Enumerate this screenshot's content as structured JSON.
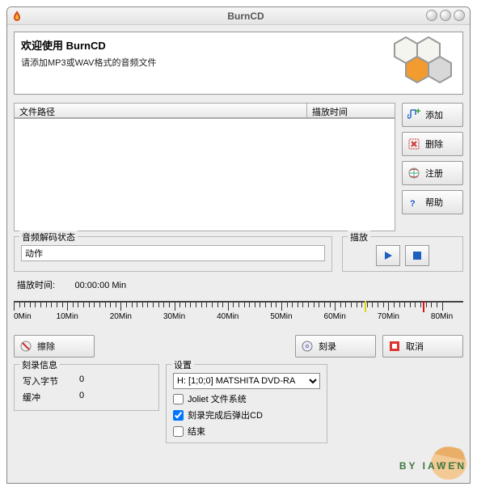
{
  "title": "BurnCD",
  "welcome": {
    "heading": "欢迎使用 BurnCD",
    "sub": "请添加MP3或WAV格式的音频文件"
  },
  "table": {
    "col_path": "文件路径",
    "col_time": "描放时间"
  },
  "sidebar": {
    "add": "添加",
    "remove": "删除",
    "register": "注册",
    "help": "帮助"
  },
  "decode": {
    "legend": "音频解码状态",
    "value": "动作"
  },
  "playback": {
    "legend": "描放"
  },
  "play_info": {
    "label": "描放时间:",
    "value": "00:00:00 Min"
  },
  "ruler": [
    "0Min",
    "10Min",
    "20Min",
    "30Min",
    "40Min",
    "50Min",
    "60Min",
    "70Min",
    "80Min"
  ],
  "bottom": {
    "erase": "擦除",
    "burn": "刻录",
    "cancel": "取消"
  },
  "burninfo": {
    "legend": "刻录信息",
    "bytes_label": "写入字节",
    "bytes_val": "0",
    "buffer_label": "缓冲",
    "buffer_val": "0"
  },
  "settings": {
    "legend": "设置",
    "drive": "H: [1;0;0] MATSHITA DVD-RA",
    "joliet": "Joliet 文件系统",
    "eject": "刻录完成后弹出CD",
    "finalize": "结束"
  },
  "watermark": "BY IAWEN"
}
